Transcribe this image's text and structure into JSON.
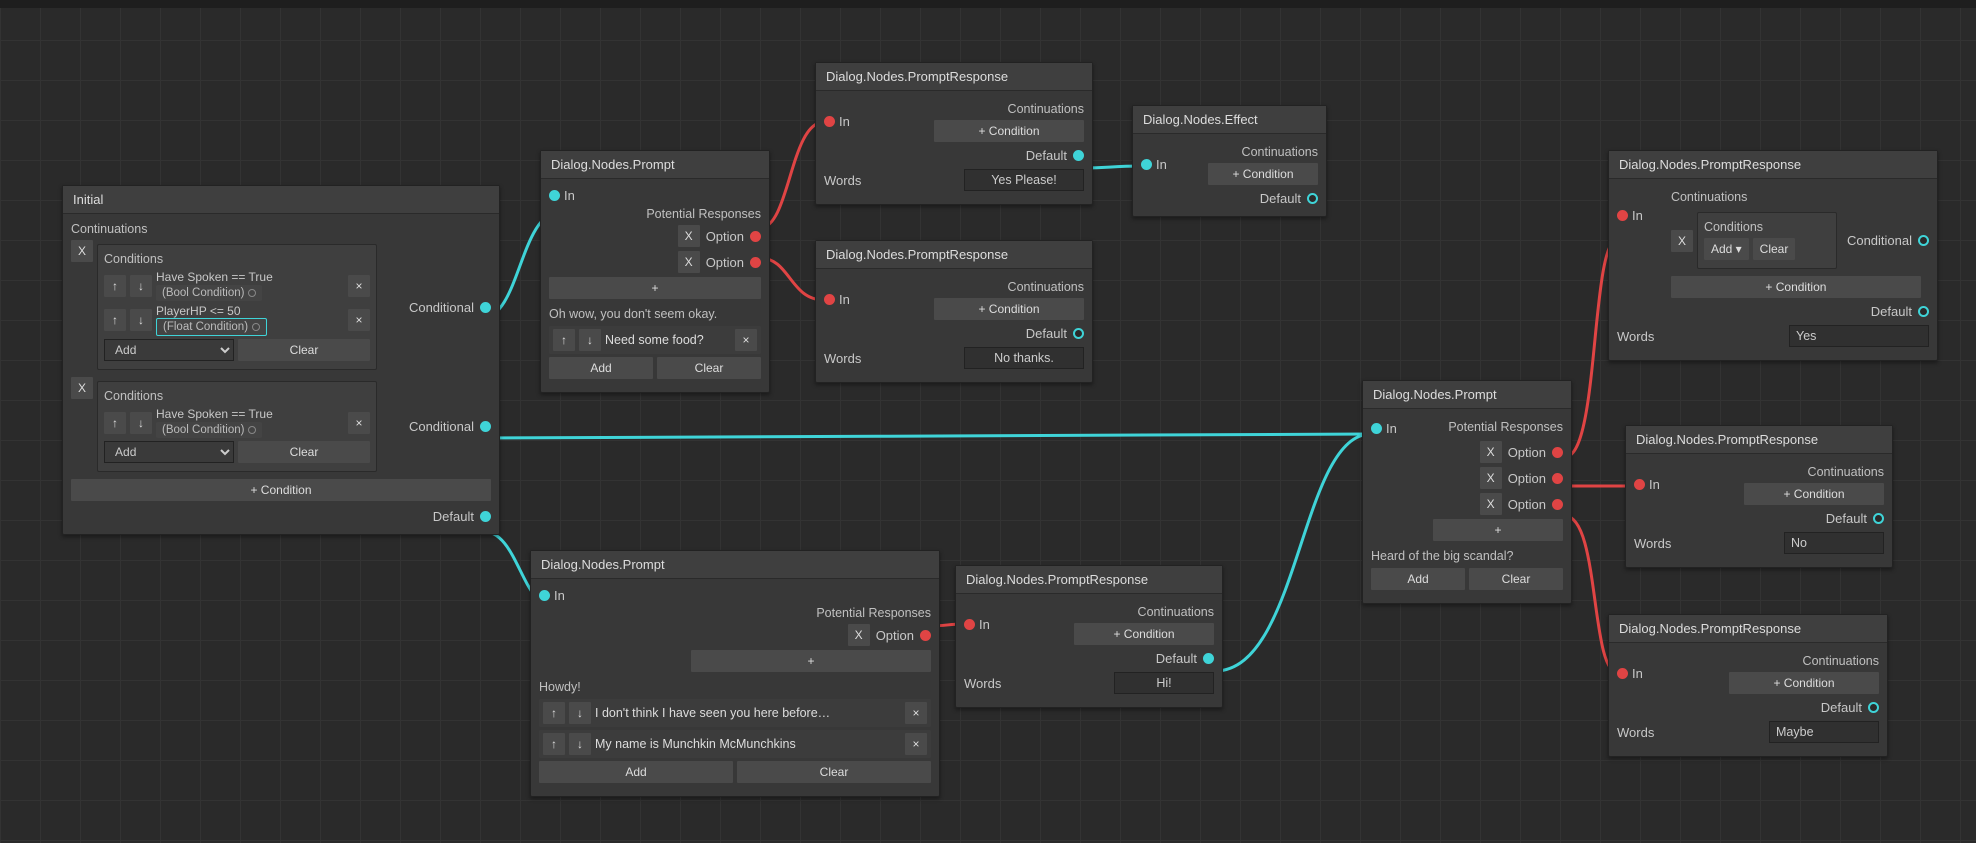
{
  "labels": {
    "in": "In",
    "default": "Default",
    "conditional": "Conditional",
    "conditions": "Conditions",
    "continuations": "Continuations",
    "potential_responses": "Potential Responses",
    "words": "Words",
    "option": "Option",
    "add": "Add",
    "clear": "Clear",
    "add_dropdown": "Add ▾",
    "plus_condition": "+ Condition",
    "plus": "+",
    "x": "X",
    "close": "×",
    "up": "↑",
    "down": "↓"
  },
  "node_types": {
    "prompt": "Dialog.Nodes.Prompt",
    "prompt_response": "Dialog.Nodes.PromptResponse",
    "effect": "Dialog.Nodes.Effect"
  },
  "nodes": {
    "initial": {
      "title": "Initial",
      "cond1_line1": "Have Spoken  ==  True",
      "cond1_chip": "(Bool Condition)",
      "cond1_line2": "PlayerHP <= 50",
      "cond1_chip2": "(Float Condition)",
      "cond2_line1": "Have Spoken  ==  True",
      "cond2_chip": "(Bool Condition)"
    },
    "prompt1": {
      "text_line1": "Oh wow, you don't seem okay.",
      "list_item": "Need some food?"
    },
    "resp_yes_please": {
      "words": "Yes Please!"
    },
    "resp_no_thanks": {
      "words": "No thanks."
    },
    "prompt2": {
      "text_line1": "Howdy!",
      "list_item1": "I don't think I have seen you here before…",
      "list_item2": "My name is Munchkin McMunchkins"
    },
    "resp_hi": {
      "words": "Hi!"
    },
    "prompt3": {
      "text_line1": "Heard of the big scandal?"
    },
    "resp_yes": {
      "words": "Yes"
    },
    "resp_no": {
      "words": "No"
    },
    "resp_maybe": {
      "words": "Maybe"
    }
  }
}
